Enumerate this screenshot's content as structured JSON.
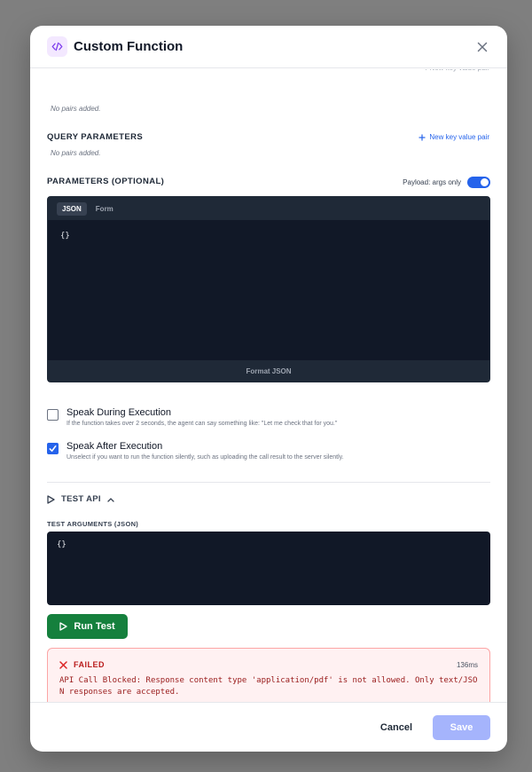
{
  "modal": {
    "title": "Custom Function",
    "icon": "code-icon"
  },
  "headers_section": {
    "empty_text": "No pairs added.",
    "add_link": "(partially hidden)"
  },
  "query_parameters": {
    "label": "QUERY PARAMETERS",
    "add_link": "New key value pair",
    "empty_text": "No pairs added."
  },
  "parameters": {
    "label": "PARAMETERS (OPTIONAL)",
    "payload_label": "Payload: args only",
    "payload_toggle_on": true,
    "tabs": [
      "JSON",
      "Form"
    ],
    "active_tab": "JSON",
    "code": "{}",
    "format_button": "Format JSON"
  },
  "options": {
    "speak_during": {
      "title": "Speak During Execution",
      "description": "If the function takes over 2 seconds, the agent can say something like: \"Let me check that for you.\"",
      "checked": false
    },
    "speak_after": {
      "title": "Speak After Execution",
      "description": "Unselect if you want to run the function silently, such as uploading the call result to the server silently.",
      "checked": true
    }
  },
  "test_api": {
    "label": "TEST API",
    "args_label": "TEST ARGUMENTS (JSON)",
    "args_code": "{}",
    "run_button": "Run Test"
  },
  "result": {
    "status": "FAILED",
    "duration": "136ms",
    "message": "API Call Blocked: Response content type 'application/pdf' is not allowed. Only text/JSON responses are accepted."
  },
  "footer": {
    "cancel": "Cancel",
    "save": "Save"
  },
  "colors": {
    "primary": "#2563eb",
    "success": "#15803d",
    "danger": "#b91c1c",
    "disabled_save": "#a5b4fc"
  }
}
